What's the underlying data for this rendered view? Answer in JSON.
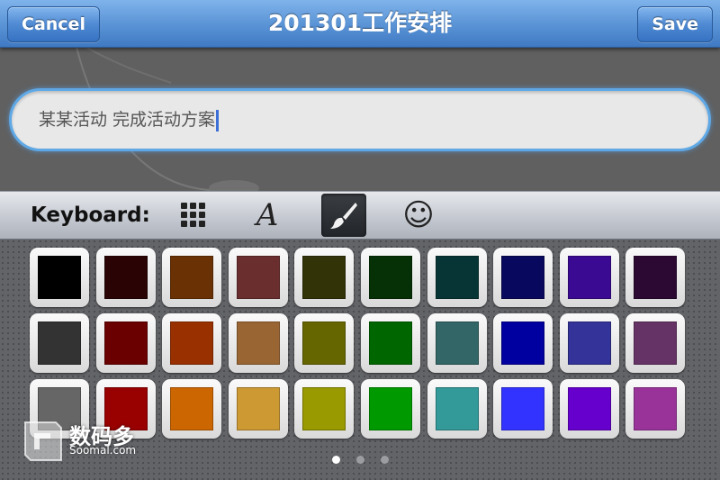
{
  "navbar": {
    "title": "201301工作安排",
    "cancel_label": "Cancel",
    "save_label": "Save"
  },
  "entry": {
    "value": "某某活动 完成活动方案"
  },
  "keyboard_bar": {
    "label": "Keyboard:",
    "buttons": [
      {
        "name": "grid-icon",
        "active": false
      },
      {
        "name": "font-icon",
        "glyph": "A",
        "active": false
      },
      {
        "name": "brush-icon",
        "active": true
      },
      {
        "name": "smiley-icon",
        "glyph": "☺",
        "active": false
      }
    ]
  },
  "palette": {
    "colors": [
      [
        "#000000",
        "#2a0404",
        "#6a3204",
        "#6a2e2e",
        "#333308",
        "#063006",
        "#073535",
        "#08085e",
        "#3a0a92",
        "#2b0933"
      ],
      [
        "#333333",
        "#6a0000",
        "#993000",
        "#996633",
        "#666600",
        "#006600",
        "#336666",
        "#0000a0",
        "#333399",
        "#663366"
      ],
      [
        "#666666",
        "#990000",
        "#cc6600",
        "#cc9933",
        "#999900",
        "#009900",
        "#339999",
        "#3333ff",
        "#6600cc",
        "#993399"
      ]
    ],
    "page_count": 3,
    "current_page": 1
  },
  "watermark": {
    "brand": "数码多",
    "site": "Soomal.com"
  }
}
